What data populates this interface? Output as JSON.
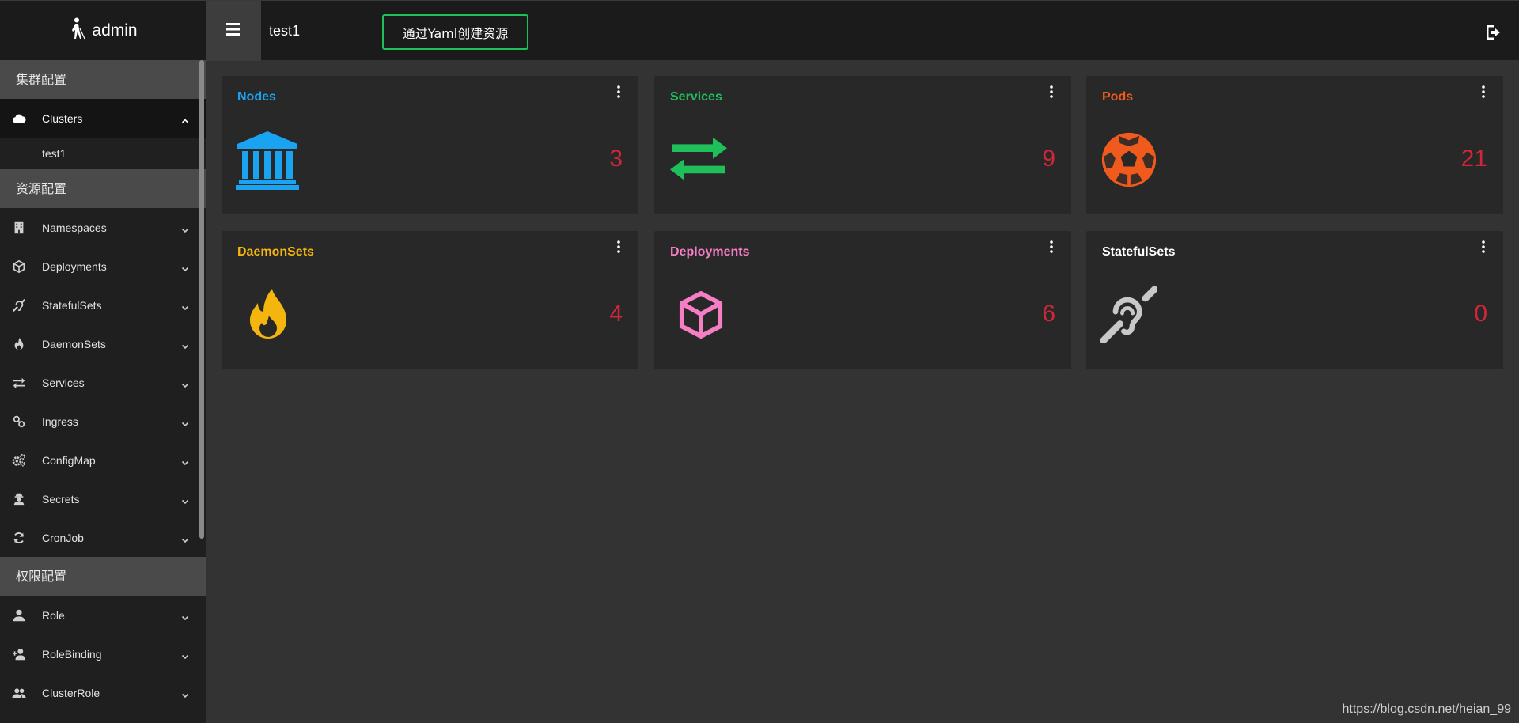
{
  "topbar": {
    "brand": "admin",
    "cluster_name": "test1",
    "yaml_button_label": "通过Yaml创建资源"
  },
  "sidebar": {
    "sections": [
      {
        "title": "集群配置"
      },
      {
        "title": "资源配置"
      },
      {
        "title": "权限配置"
      }
    ],
    "cluster_items": [
      {
        "label": "Clusters",
        "icon": "cloud-icon",
        "expanded": true
      }
    ],
    "cluster_sub_items": [
      {
        "label": "test1"
      }
    ],
    "resource_items": [
      {
        "label": "Namespaces",
        "icon": "building-icon"
      },
      {
        "label": "Deployments",
        "icon": "cube-icon"
      },
      {
        "label": "StatefulSets",
        "icon": "deaf-icon"
      },
      {
        "label": "DaemonSets",
        "icon": "fire-icon"
      },
      {
        "label": "Services",
        "icon": "exchange-icon"
      },
      {
        "label": "Ingress",
        "icon": "link-icon"
      },
      {
        "label": "ConfigMap",
        "icon": "gears-icon"
      },
      {
        "label": "Secrets",
        "icon": "user-secret-icon"
      },
      {
        "label": "CronJob",
        "icon": "sync-icon"
      }
    ],
    "permission_items": [
      {
        "label": "Role",
        "icon": "user-icon"
      },
      {
        "label": "RoleBinding",
        "icon": "user-plus-icon"
      },
      {
        "label": "ClusterRole",
        "icon": "users-icon"
      }
    ]
  },
  "cards": [
    {
      "title": "Nodes",
      "count": "3",
      "color": "#1aa3f0",
      "icon": "university-icon"
    },
    {
      "title": "Services",
      "count": "9",
      "color": "#1fbf5a",
      "icon": "exchange-icon"
    },
    {
      "title": "Pods",
      "count": "21",
      "color": "#f05a1c",
      "icon": "futbol-icon"
    },
    {
      "title": "DaemonSets",
      "count": "4",
      "color": "#f5b50f",
      "icon": "fire-icon"
    },
    {
      "title": "Deployments",
      "count": "6",
      "color": "#f57ec4",
      "icon": "cube-icon"
    },
    {
      "title": "StatefulSets",
      "count": "0",
      "color": "#ffffff",
      "icon": "deaf-icon"
    }
  ],
  "count_color": "#d0263a",
  "watermark": "https://blog.csdn.net/heian_99"
}
